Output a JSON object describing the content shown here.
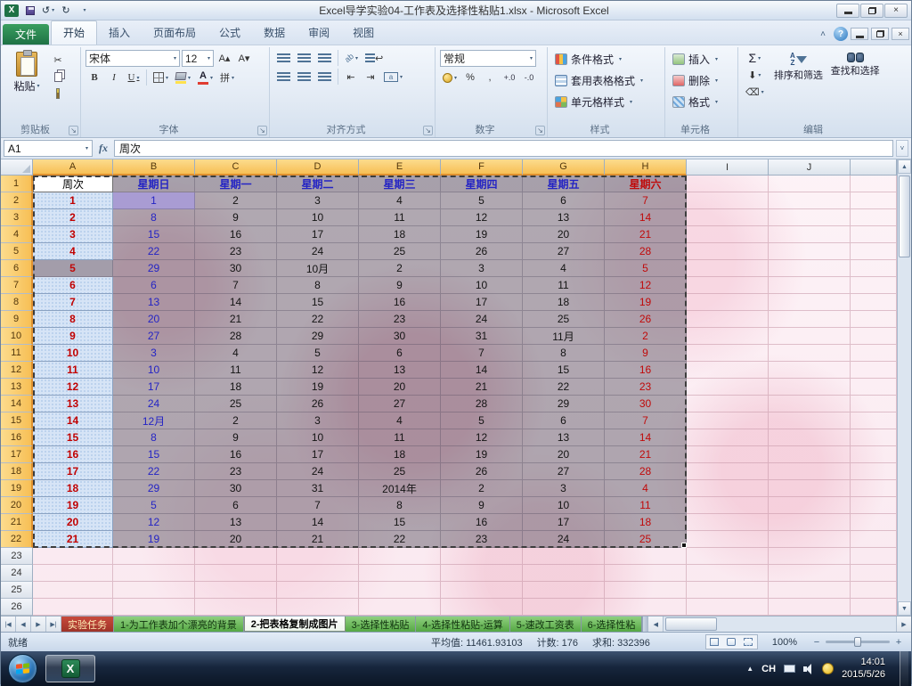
{
  "window": {
    "title": "Excel导学实验04-工作表及选择性粘贴1.xlsx - Microsoft Excel"
  },
  "ribbon": {
    "file_tab": "文件",
    "tabs": [
      "开始",
      "插入",
      "页面布局",
      "公式",
      "数据",
      "审阅",
      "视图"
    ],
    "active_tab": "开始",
    "clipboard": {
      "label": "剪贴板",
      "paste": "粘贴"
    },
    "font": {
      "label": "字体",
      "name": "宋体",
      "size": "12"
    },
    "alignment": {
      "label": "对齐方式"
    },
    "number": {
      "label": "数字",
      "format": "常规"
    },
    "styles": {
      "label": "样式",
      "buttons": [
        "条件格式",
        "套用表格格式",
        "单元格样式"
      ]
    },
    "cells": {
      "label": "单元格",
      "buttons": [
        "插入",
        "删除",
        "格式"
      ]
    },
    "editing": {
      "label": "编辑",
      "buttons": [
        "排序和筛选",
        "查找和选择"
      ]
    }
  },
  "formula_bar": {
    "name_box": "A1",
    "fx": "fx",
    "value": "周次"
  },
  "grid": {
    "columns": [
      "A",
      "B",
      "C",
      "D",
      "E",
      "F",
      "G",
      "H",
      "I",
      "J"
    ],
    "selected_columns": 8,
    "rows_total": 26,
    "selected_rows": 22
  },
  "table": {
    "headers": [
      "周次",
      "星期日",
      "星期一",
      "星期二",
      "星期三",
      "星期四",
      "星期五",
      "星期六"
    ],
    "rows": [
      [
        "1",
        "1",
        "2",
        "3",
        "4",
        "5",
        "6",
        "7"
      ],
      [
        "2",
        "8",
        "9",
        "10",
        "11",
        "12",
        "13",
        "14"
      ],
      [
        "3",
        "15",
        "16",
        "17",
        "18",
        "19",
        "20",
        "21"
      ],
      [
        "4",
        "22",
        "23",
        "24",
        "25",
        "26",
        "27",
        "28"
      ],
      [
        "5",
        "29",
        "30",
        "10月",
        "2",
        "3",
        "4",
        "5"
      ],
      [
        "6",
        "6",
        "7",
        "8",
        "9",
        "10",
        "11",
        "12"
      ],
      [
        "7",
        "13",
        "14",
        "15",
        "16",
        "17",
        "18",
        "19"
      ],
      [
        "8",
        "20",
        "21",
        "22",
        "23",
        "24",
        "25",
        "26"
      ],
      [
        "9",
        "27",
        "28",
        "29",
        "30",
        "31",
        "11月",
        "2"
      ],
      [
        "10",
        "3",
        "4",
        "5",
        "6",
        "7",
        "8",
        "9"
      ],
      [
        "11",
        "10",
        "11",
        "12",
        "13",
        "14",
        "15",
        "16"
      ],
      [
        "12",
        "17",
        "18",
        "19",
        "20",
        "21",
        "22",
        "23"
      ],
      [
        "13",
        "24",
        "25",
        "26",
        "27",
        "28",
        "29",
        "30"
      ],
      [
        "14",
        "12月",
        "2",
        "3",
        "4",
        "5",
        "6",
        "7"
      ],
      [
        "15",
        "8",
        "9",
        "10",
        "11",
        "12",
        "13",
        "14"
      ],
      [
        "16",
        "15",
        "16",
        "17",
        "18",
        "19",
        "20",
        "21"
      ],
      [
        "17",
        "22",
        "23",
        "24",
        "25",
        "26",
        "27",
        "28"
      ],
      [
        "18",
        "29",
        "30",
        "31",
        "2014年",
        "2",
        "3",
        "4"
      ],
      [
        "19",
        "5",
        "6",
        "7",
        "8",
        "9",
        "10",
        "11"
      ],
      [
        "20",
        "12",
        "13",
        "14",
        "15",
        "16",
        "17",
        "18"
      ],
      [
        "21",
        "19",
        "20",
        "21",
        "22",
        "23",
        "24",
        "25"
      ]
    ]
  },
  "sheet_tabs": {
    "tabs": [
      {
        "label": "实验任务",
        "color": "red"
      },
      {
        "label": "1-为工作表加个漂亮的背景",
        "color": "green"
      },
      {
        "label": "2-把表格复制成图片",
        "color": "active"
      },
      {
        "label": "3-选择性粘贴",
        "color": "green"
      },
      {
        "label": "4-选择性粘贴-运算",
        "color": "green"
      },
      {
        "label": "5-速改工资表",
        "color": "green"
      },
      {
        "label": "6-选择性粘",
        "color": "green"
      }
    ]
  },
  "status_bar": {
    "mode": "就绪",
    "average_label": "平均值: 11461.93103",
    "count_label": "计数: 176",
    "sum_label": "求和: 332396",
    "zoom": "100%"
  },
  "taskbar": {
    "language": "CH",
    "time": "14:01",
    "date": "2015/5/26"
  },
  "colors": {
    "selected_header": "#f7bf55",
    "week_number_text": "#c00000",
    "weekday_text": "#2424c4",
    "saturday_text": "#c00a0a",
    "file_tab_green": "#1e7145"
  }
}
